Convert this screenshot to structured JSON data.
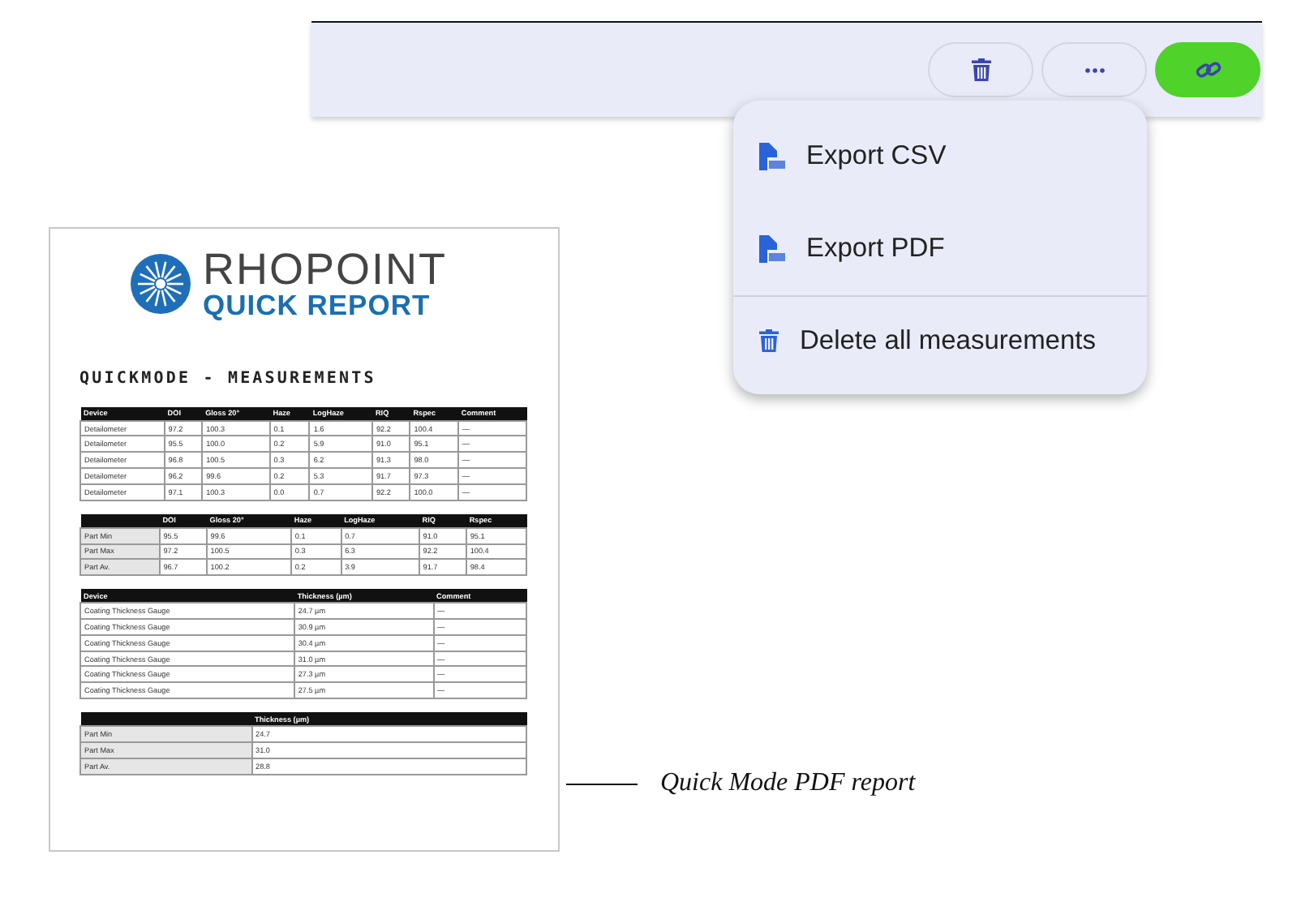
{
  "toolbar": {
    "buttons": [
      {
        "kind": "delete"
      },
      {
        "kind": "more"
      },
      {
        "kind": "link"
      }
    ]
  },
  "menu": {
    "groups": [
      [
        {
          "kind": "csv",
          "label": "Export CSV"
        },
        {
          "kind": "pdf",
          "label": "Export PDF"
        }
      ],
      [
        {
          "kind": "delete",
          "label": "Delete all measurements"
        }
      ]
    ]
  },
  "report": {
    "logo": {
      "name": "RHOPOINT",
      "subtitle": "QUICK REPORT"
    },
    "heading": "QUICKMODE - MEASUREMENTS",
    "tables": [
      {
        "kind": "list",
        "columns": [
          "Device",
          "DOI",
          "Gloss 20°",
          "Haze",
          "LogHaze",
          "RIQ",
          "Rspec",
          "Comment"
        ],
        "rows": [
          [
            "Detailometer",
            "97.2",
            "100.3",
            "0.1",
            "1.6",
            "92.2",
            "100.4",
            "—"
          ],
          [
            "Detailometer",
            "95.5",
            "100.0",
            "0.2",
            "5.9",
            "91.0",
            "95.1",
            "—"
          ],
          [
            "Detailometer",
            "96.8",
            "100.5",
            "0.3",
            "6.2",
            "91.3",
            "98.0",
            "—"
          ],
          [
            "Detailometer",
            "96.2",
            "99.6",
            "0.2",
            "5.3",
            "91.7",
            "97.3",
            "—"
          ],
          [
            "Detailometer",
            "97.1",
            "100.3",
            "0.0",
            "0.7",
            "92.2",
            "100.0",
            "—"
          ]
        ]
      },
      {
        "kind": "summary",
        "columns": [
          "",
          "DOI",
          "Gloss 20°",
          "Haze",
          "LogHaze",
          "RIQ",
          "Rspec"
        ],
        "rows": [
          [
            "Part Min",
            "95.5",
            "99.6",
            "0.1",
            "0.7",
            "91.0",
            "95.1"
          ],
          [
            "Part Max",
            "97.2",
            "100.5",
            "0.3",
            "6.3",
            "92.2",
            "100.4"
          ],
          [
            "Part Av.",
            "96.7",
            "100.2",
            "0.2",
            "3.9",
            "91.7",
            "98.4"
          ]
        ]
      },
      {
        "kind": "list",
        "columns": [
          "Device",
          "Thickness (µm)",
          "Comment"
        ],
        "rows": [
          [
            "Coating Thickness Gauge",
            "24.7 µm",
            "—"
          ],
          [
            "Coating Thickness Gauge",
            "30.9 µm",
            "—"
          ],
          [
            "Coating Thickness Gauge",
            "30.4 µm",
            "—"
          ],
          [
            "Coating Thickness Gauge",
            "31.0 µm",
            "—"
          ],
          [
            "Coating Thickness Gauge",
            "27.3 µm",
            "—"
          ],
          [
            "Coating Thickness Gauge",
            "27.5 µm",
            "—"
          ]
        ]
      },
      {
        "kind": "summary",
        "columns": [
          "",
          "Thickness (µm)"
        ],
        "rows": [
          [
            "Part Min",
            "24.7"
          ],
          [
            "Part Max",
            "31.0"
          ],
          [
            "Part Av.",
            "28.8"
          ]
        ]
      }
    ]
  },
  "caption": "Quick Mode PDF report"
}
